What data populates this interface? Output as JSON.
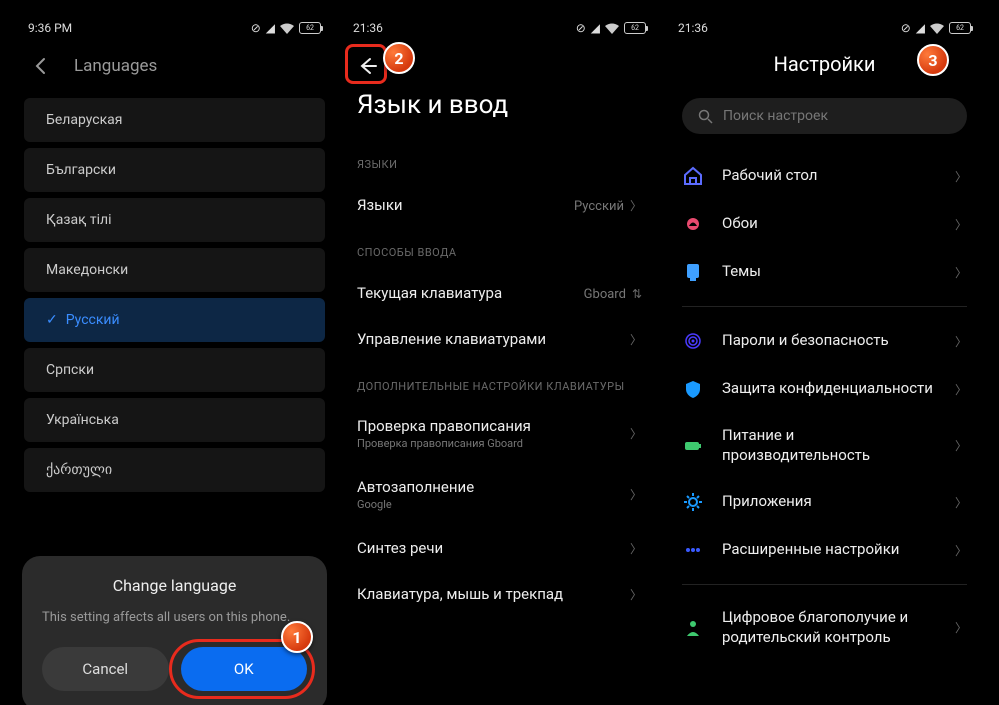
{
  "screens": [
    {
      "time": "9:36 PM",
      "battery": "62"
    },
    {
      "time": "21:36",
      "battery": "62"
    },
    {
      "time": "21:36",
      "battery": "62"
    }
  ],
  "s1": {
    "title": "Languages",
    "langs": [
      "Беларуская",
      "Български",
      "Қазақ тілі",
      "Македонски",
      "Русский",
      "Српски",
      "Українська",
      "ქართული"
    ],
    "selected_index": 4,
    "dialog": {
      "title": "Change language",
      "msg": "This setting affects all users on this phone.",
      "cancel": "Cancel",
      "ok": "OK"
    }
  },
  "s2": {
    "page_title": "Язык и ввод",
    "sec_langs": "ЯЗЫКИ",
    "row_langs": "Языки",
    "row_langs_val": "Русский",
    "sec_input": "СПОСОБЫ ВВОДА",
    "row_kbd": "Текущая клавиатура",
    "row_kbd_val": "Gboard",
    "row_manage": "Управление клавиатурами",
    "sec_extra": "ДОПОЛНИТЕЛЬНЫЕ НАСТРОЙКИ КЛАВИАТУРЫ",
    "row_spell": "Проверка правописания",
    "row_spell_sub": "Проверка правописания Gboard",
    "row_autofill": "Автозаполнение",
    "row_autofill_sub": "Google",
    "row_tts": "Синтез речи",
    "row_kmt": "Клавиатура, мышь и трекпад"
  },
  "s3": {
    "title": "Настройки",
    "search_placeholder": "Поиск настроек",
    "items": [
      {
        "label": "Рабочий стол",
        "icon": "home",
        "color": "#5c6cff"
      },
      {
        "label": "Обои",
        "icon": "wallpaper",
        "color": "#e84a6f"
      },
      {
        "label": "Темы",
        "icon": "themes",
        "color": "#3fa0ff"
      },
      {
        "label": "Пароли и безопасность",
        "icon": "fingerprint",
        "color": "#4a3aff"
      },
      {
        "label": "Защита конфиденциальности",
        "icon": "shield",
        "color": "#1a9aff"
      },
      {
        "label": "Питание и производительность",
        "icon": "battery",
        "color": "#3ec96f"
      },
      {
        "label": "Приложения",
        "icon": "gear",
        "color": "#1a9aff"
      },
      {
        "label": "Расширенные настройки",
        "icon": "dots",
        "color": "#3a5aff"
      },
      {
        "label": "Цифровое благополучие и родительский контроль",
        "icon": "wellbeing",
        "color": "#3ec96f"
      }
    ]
  },
  "badges": [
    "1",
    "2",
    "3"
  ]
}
